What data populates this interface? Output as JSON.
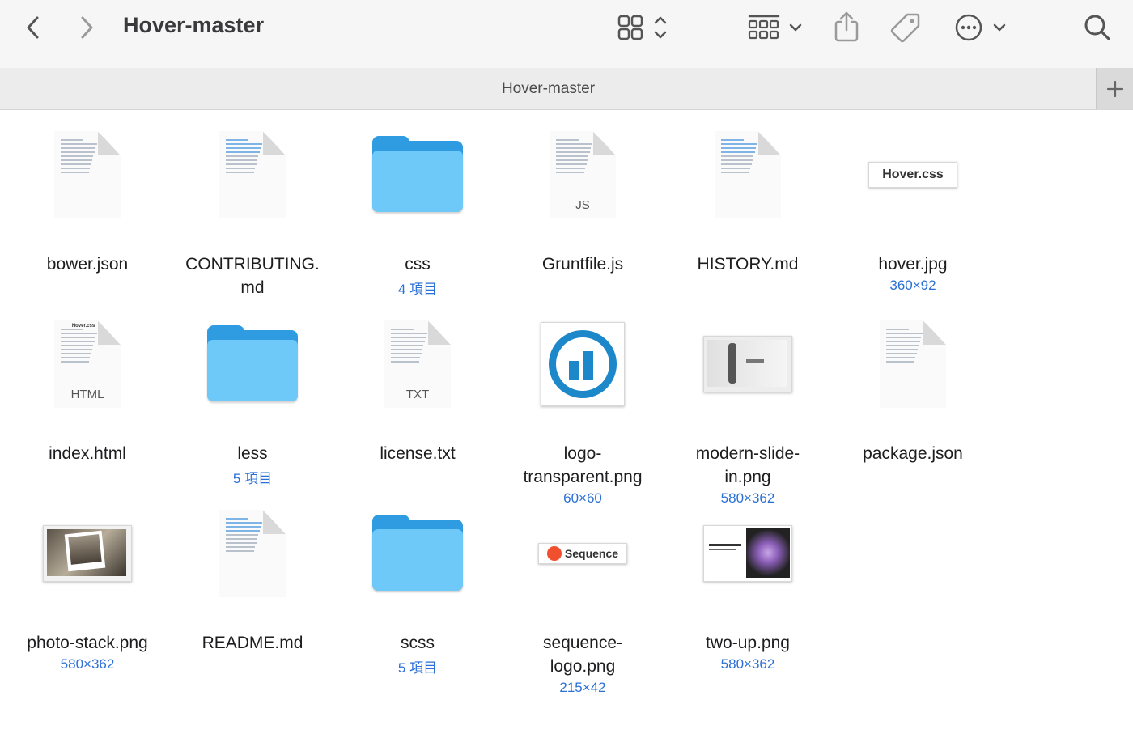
{
  "window": {
    "title": "Hover-master",
    "tab_label": "Hover-master"
  },
  "toolbar": {
    "back_icon": "chevron-left-icon",
    "forward_icon": "chevron-right-icon",
    "view_icon": "icon-grid-icon",
    "group_icon": "group-grid-icon",
    "share_icon": "share-icon",
    "tag_icon": "tag-icon",
    "more_icon": "ellipsis-circle-icon",
    "search_icon": "search-icon",
    "add_tab_icon": "plus-icon"
  },
  "colors": {
    "accent": "#2a6fd6",
    "folder": "#6ec8f8",
    "folder_dark": "#2f9be0"
  },
  "files": [
    {
      "name": "bower.json",
      "meta": "",
      "kind": "doc",
      "ext": ""
    },
    {
      "name": "CONTRIBUTING.\nmd",
      "meta": "",
      "kind": "doc-md",
      "ext": ""
    },
    {
      "name": "css",
      "meta": "4 項目",
      "kind": "folder",
      "ext": ""
    },
    {
      "name": "Gruntfile.js",
      "meta": "",
      "kind": "doc",
      "ext": "JS"
    },
    {
      "name": "HISTORY.md",
      "meta": "",
      "kind": "doc-md",
      "ext": ""
    },
    {
      "name": "hover.jpg",
      "meta": "360×92",
      "kind": "img-hover",
      "ext": "",
      "thumb_text": "Hover.css"
    },
    {
      "name": "index.html",
      "meta": "",
      "kind": "doc",
      "ext": "HTML",
      "thumb_text": "Hover.css"
    },
    {
      "name": "less",
      "meta": "5 項目",
      "kind": "folder",
      "ext": ""
    },
    {
      "name": "license.txt",
      "meta": "",
      "kind": "doc",
      "ext": "TXT"
    },
    {
      "name": "logo-\ntransparent.png",
      "meta": "60×60",
      "kind": "img-logo",
      "ext": ""
    },
    {
      "name": "modern-slide-\nin.png",
      "meta": "580×362",
      "kind": "img-slide",
      "ext": ""
    },
    {
      "name": "package.json",
      "meta": "",
      "kind": "doc",
      "ext": ""
    },
    {
      "name": "photo-stack.png",
      "meta": "580×362",
      "kind": "img-photo",
      "ext": ""
    },
    {
      "name": "README.md",
      "meta": "",
      "kind": "doc-md",
      "ext": ""
    },
    {
      "name": "scss",
      "meta": "5 項目",
      "kind": "folder",
      "ext": ""
    },
    {
      "name": "sequence-\nlogo.png",
      "meta": "215×42",
      "kind": "img-seq",
      "ext": "",
      "thumb_text": "Sequence"
    },
    {
      "name": "two-up.png",
      "meta": "580×362",
      "kind": "img-twoup",
      "ext": ""
    }
  ]
}
